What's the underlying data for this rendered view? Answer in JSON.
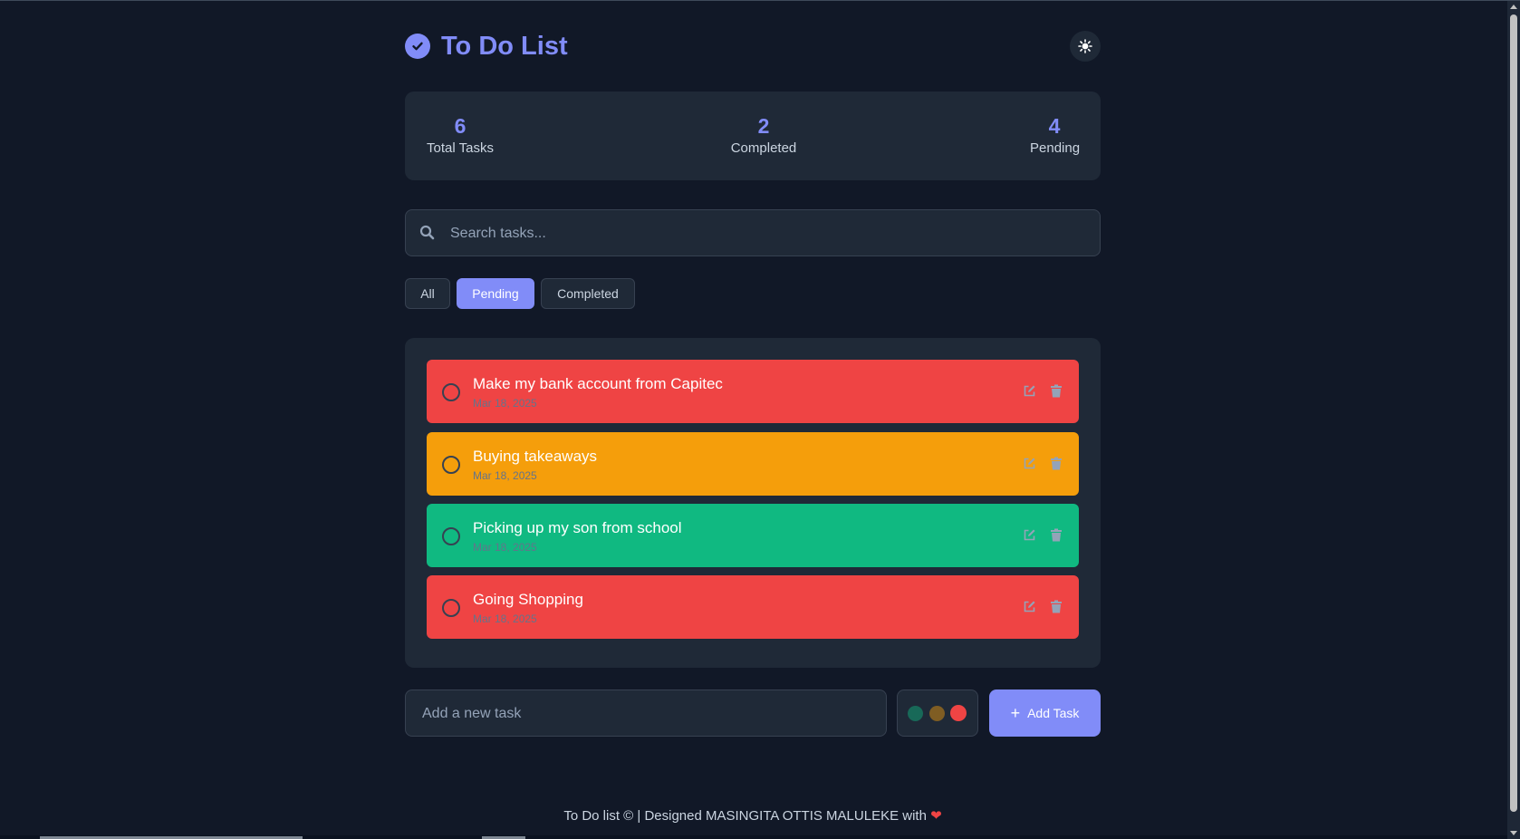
{
  "header": {
    "title": "To Do List"
  },
  "stats": [
    {
      "value": "6",
      "label": "Total Tasks"
    },
    {
      "value": "2",
      "label": "Completed"
    },
    {
      "value": "4",
      "label": "Pending"
    }
  ],
  "search": {
    "placeholder": "Search tasks...",
    "value": ""
  },
  "filters": {
    "items": [
      "All",
      "Pending",
      "Completed"
    ],
    "active": "Pending"
  },
  "tasks": [
    {
      "name": "Make my bank account from Capitec",
      "date": "Mar 18, 2025",
      "color": "#ef4444"
    },
    {
      "name": "Buying takeaways",
      "date": "Mar 18, 2025",
      "color": "#f59e0b"
    },
    {
      "name": "Picking up my son from school",
      "date": "Mar 18, 2025",
      "color": "#10b981"
    },
    {
      "name": "Going Shopping",
      "date": "Mar 18, 2025",
      "color": "#ef4444"
    }
  ],
  "add_task": {
    "placeholder": "Add a new task",
    "button_label": "Add Task",
    "colors": [
      "#10b981",
      "#f59e0b",
      "#ef4444"
    ],
    "selected_color": "#ef4444"
  },
  "footer": {
    "text": "To Do list © | Designed MASINGITA OTTIS MALULEKE with",
    "heart": "❤"
  },
  "colors": {
    "accent": "#818cf8",
    "background": "#111827",
    "panel": "#1f2937"
  }
}
